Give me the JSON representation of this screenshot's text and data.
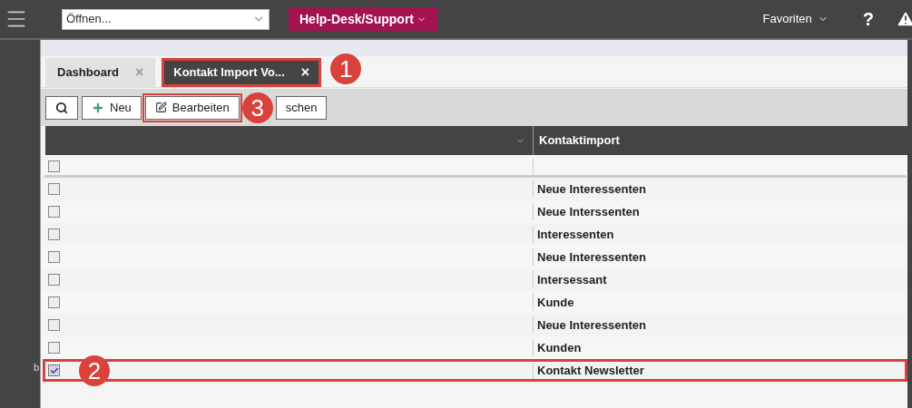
{
  "topbar": {
    "open_select": {
      "value": "Öffnen..."
    },
    "module_button": {
      "label": "Help-Desk/Support"
    },
    "favorites": {
      "label": "Favoriten"
    },
    "help": {
      "label": "?"
    }
  },
  "tabs": [
    {
      "label": "Dashboard",
      "close": "×",
      "selected": false,
      "highlighted": false
    },
    {
      "label": "Kontakt Import Vo...",
      "close": "×",
      "selected": true,
      "highlighted": true,
      "callout": "1"
    }
  ],
  "toolbar": [
    {
      "kind": "search",
      "highlighted": false
    },
    {
      "kind": "new",
      "label": "Neu",
      "highlighted": false
    },
    {
      "kind": "edit",
      "label": "Bearbeiten",
      "highlighted": true,
      "callout": "3"
    },
    {
      "kind": "plain",
      "label": "schen",
      "highlighted": false
    }
  ],
  "table": {
    "columns": [
      "",
      "Kontaktimport"
    ],
    "rows": [
      {
        "checked": false,
        "highlighted": false
      },
      {
        "checked": false,
        "value": "Neue Interessenten",
        "highlighted": false
      },
      {
        "checked": false,
        "value": "Neue Interssenten",
        "highlighted": false
      },
      {
        "checked": false,
        "value": "Interessenten",
        "highlighted": false
      },
      {
        "checked": false,
        "value": "Neue Interessenten",
        "highlighted": false
      },
      {
        "checked": false,
        "value": "Intersessant",
        "highlighted": false
      },
      {
        "checked": false,
        "value": "Kunde",
        "highlighted": false
      },
      {
        "checked": false,
        "value": "Neue Interessenten",
        "highlighted": false
      },
      {
        "checked": false,
        "value": "Kunden",
        "highlighted": false
      },
      {
        "marker": "b",
        "checked": true,
        "value": "Kontakt Newsletter",
        "highlighted": true,
        "callout": "2"
      }
    ]
  }
}
